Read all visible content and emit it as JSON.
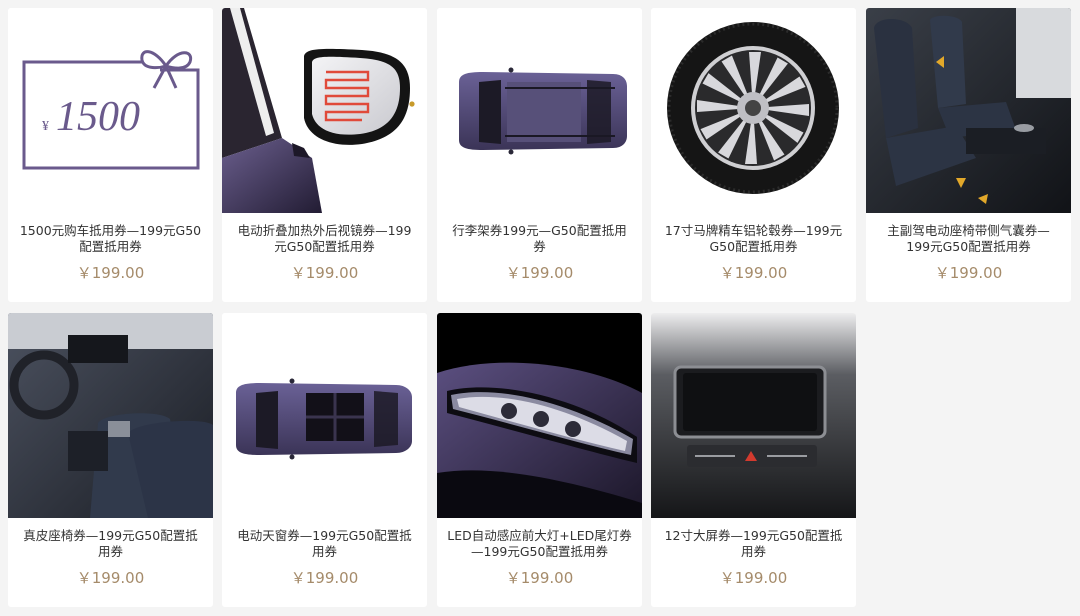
{
  "colors": {
    "background": "#f4f4f4",
    "card": "#ffffff",
    "price": "#a58b6a",
    "title": "#333333",
    "car_purple": "#4d4672"
  },
  "products": [
    {
      "title": "1500元购车抵用券—199元G50配置抵用券",
      "price": "￥199.00",
      "image": "gift-voucher-image",
      "voucher_amount": "1500",
      "currency_symbol": "¥"
    },
    {
      "title": "电动折叠加热外后视镜券—199元G50配置抵用券",
      "price": "￥199.00",
      "image": "heated-mirror-image"
    },
    {
      "title": "行李架券199元—G50配置抵用券",
      "price": "￥199.00",
      "image": "roof-rack-image"
    },
    {
      "title": "17寸马牌精车铝轮毂券—199元G50配置抵用券",
      "price": "￥199.00",
      "image": "alloy-wheel-image"
    },
    {
      "title": "主副驾电动座椅带侧气囊券—199元G50配置抵用券",
      "price": "￥199.00",
      "image": "power-seat-image"
    },
    {
      "title": "真皮座椅券—199元G50配置抵用券",
      "price": "￥199.00",
      "image": "leather-seat-image"
    },
    {
      "title": "电动天窗券—199元G50配置抵用券",
      "price": "￥199.00",
      "image": "sunroof-image"
    },
    {
      "title": "LED自动感应前大灯+LED尾灯券—199元G50配置抵用券",
      "price": "￥199.00",
      "image": "led-headlight-image"
    },
    {
      "title": "12寸大屏券—199元G50配置抵用券",
      "price": "￥199.00",
      "image": "large-screen-image"
    }
  ]
}
